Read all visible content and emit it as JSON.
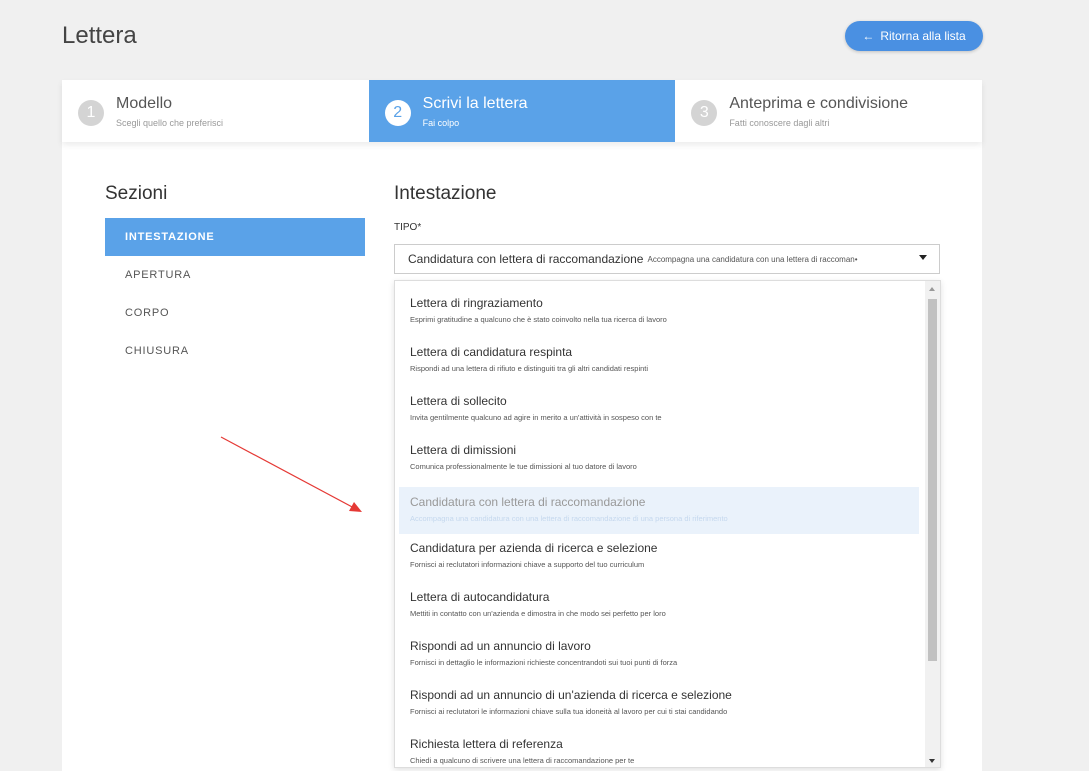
{
  "page": {
    "title": "Lettera",
    "back_label": "Ritorna alla lista"
  },
  "steps": [
    {
      "num": "1",
      "title": "Modello",
      "subtitle": "Scegli quello che preferisci"
    },
    {
      "num": "2",
      "title": "Scrivi la lettera",
      "subtitle": "Fai colpo"
    },
    {
      "num": "3",
      "title": "Anteprima e condivisione",
      "subtitle": "Fatti conoscere dagli altri"
    }
  ],
  "sidebar": {
    "heading": "Sezioni",
    "items": [
      "INTESTAZIONE",
      "APERTURA",
      "CORPO",
      "CHIUSURA"
    ]
  },
  "main": {
    "heading": "Intestazione",
    "field_label": "TIPO*",
    "selected_title": "Candidatura con lettera di raccomandazione",
    "selected_desc": "Accompagna una candidatura con una lettera di raccoman•"
  },
  "options": [
    {
      "title": "Lettera di ringraziamento",
      "desc": "Esprimi gratitudine a qualcuno che è stato coinvolto nella tua ricerca di lavoro"
    },
    {
      "title": "Lettera di candidatura respinta",
      "desc": "Rispondi ad una lettera di rifiuto e distinguiti tra gli altri candidati respinti"
    },
    {
      "title": "Lettera di sollecito",
      "desc": "Invita gentilmente qualcuno ad agire in merito a un'attività in sospeso con te"
    },
    {
      "title": "Lettera di dimissioni",
      "desc": "Comunica professionalmente le tue dimissioni al tuo datore di lavoro"
    },
    {
      "title": "Candidatura con lettera di raccomandazione",
      "desc": "Accompagna una candidatura con una lettera di raccomandazione di una persona di riferimento"
    },
    {
      "title": "Candidatura per azienda di ricerca e selezione",
      "desc": "Fornisci ai reclutatori informazioni chiave a supporto del tuo curriculum"
    },
    {
      "title": "Lettera di autocandidatura",
      "desc": "Mettiti in contatto con un'azienda e dimostra in che modo sei perfetto per loro"
    },
    {
      "title": "Rispondi ad un annuncio di lavoro",
      "desc": "Fornisci in dettaglio le informazioni richieste concentrandoti sui tuoi punti di forza"
    },
    {
      "title": "Rispondi ad un annuncio di un'azienda di ricerca e selezione",
      "desc": "Fornisci ai reclutatori le informazioni chiave sulla tua idoneità al lavoro per cui ti stai candidando"
    },
    {
      "title": "Richiesta lettera di referenza",
      "desc": "Chiedi a qualcuno di scrivere una lettera di raccomandazione per te"
    }
  ],
  "colors": {
    "accent": "#5aa2e8",
    "button": "#4a90e2",
    "annotation": "#e53935"
  }
}
